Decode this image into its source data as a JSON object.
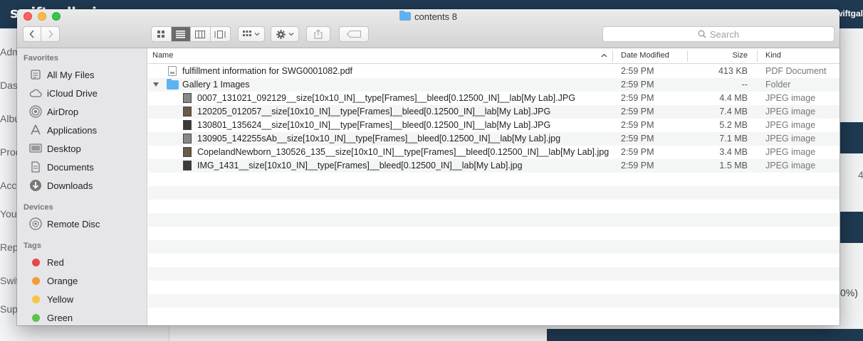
{
  "background": {
    "logo": "swiftgalleries",
    "user_label": "Hi, Swiftgal",
    "nav_items": [
      "Adm",
      "Das",
      "Albu",
      "Prod",
      "Acc",
      "Your",
      "Rep",
      "Swit",
      "Sup"
    ],
    "right_text": "0%)",
    "right_text2": "4"
  },
  "window": {
    "title": "contents 8",
    "toolbar": {
      "back_icon": "chevron-left-icon",
      "forward_icon": "chevron-right-icon",
      "view_modes": [
        "icon-view-icon",
        "list-view-icon",
        "column-view-icon",
        "cover-flow-icon"
      ],
      "active_view": "list-view-icon",
      "search_placeholder": "Search"
    }
  },
  "sidebar": {
    "favorites_heading": "Favorites",
    "favorites": [
      {
        "label": "All My Files",
        "icon": "all-files-icon"
      },
      {
        "label": "iCloud Drive",
        "icon": "cloud-icon"
      },
      {
        "label": "AirDrop",
        "icon": "airdrop-icon"
      },
      {
        "label": "Applications",
        "icon": "applications-icon"
      },
      {
        "label": "Desktop",
        "icon": "desktop-icon"
      },
      {
        "label": "Documents",
        "icon": "documents-icon"
      },
      {
        "label": "Downloads",
        "icon": "downloads-icon"
      }
    ],
    "devices_heading": "Devices",
    "devices": [
      {
        "label": "Remote Disc",
        "icon": "disc-icon"
      }
    ],
    "tags_heading": "Tags",
    "tags": [
      {
        "label": "Red",
        "color": "#e5484d"
      },
      {
        "label": "Orange",
        "color": "#f29b38"
      },
      {
        "label": "Yellow",
        "color": "#f4c542"
      },
      {
        "label": "Green",
        "color": "#5cc248"
      }
    ]
  },
  "file_list": {
    "columns": {
      "name": "Name",
      "date": "Date Modified",
      "size": "Size",
      "kind": "Kind"
    },
    "rows": [
      {
        "name": "fulfillment information for SWG0001082.pdf",
        "date": "2:59 PM",
        "size": "413 KB",
        "kind": "PDF Document",
        "type": "pdf",
        "level": 0
      },
      {
        "name": "Gallery 1 Images",
        "date": "2:59 PM",
        "size": "--",
        "kind": "Folder",
        "type": "folder",
        "level": 0
      },
      {
        "name": "0007_131021_092129__size[10x10_IN]__type[Frames]__bleed[0.12500_IN]__lab[My Lab].JPG",
        "date": "2:59 PM",
        "size": "4.4 MB",
        "kind": "JPEG image",
        "type": "image",
        "level": 1
      },
      {
        "name": "120205_012057__size[10x10_IN]__type[Frames]__bleed[0.12500_IN]__lab[My Lab].JPG",
        "date": "2:59 PM",
        "size": "7.4 MB",
        "kind": "JPEG image",
        "type": "image",
        "level": 1
      },
      {
        "name": "130801_135624__size[10x10_IN]__type[Frames]__bleed[0.12500_IN]__lab[My Lab].JPG",
        "date": "2:59 PM",
        "size": "5.2 MB",
        "kind": "JPEG image",
        "type": "image",
        "level": 1
      },
      {
        "name": "130905_142255sAb__size[10x10_IN]__type[Frames]__bleed[0.12500_IN]__lab[My Lab].jpg",
        "date": "2:59 PM",
        "size": "7.1 MB",
        "kind": "JPEG image",
        "type": "image",
        "level": 1
      },
      {
        "name": "CopelandNewborn_130526_135__size[10x10_IN]__type[Frames]__bleed[0.12500_IN]__lab[My Lab].jpg",
        "date": "2:59 PM",
        "size": "3.4 MB",
        "kind": "JPEG image",
        "type": "image",
        "level": 1
      },
      {
        "name": "IMG_1431__size[10x10_IN]__type[Frames]__bleed[0.12500_IN]__lab[My Lab].jpg",
        "date": "2:59 PM",
        "size": "1.5 MB",
        "kind": "JPEG image",
        "type": "image",
        "level": 1
      }
    ]
  }
}
